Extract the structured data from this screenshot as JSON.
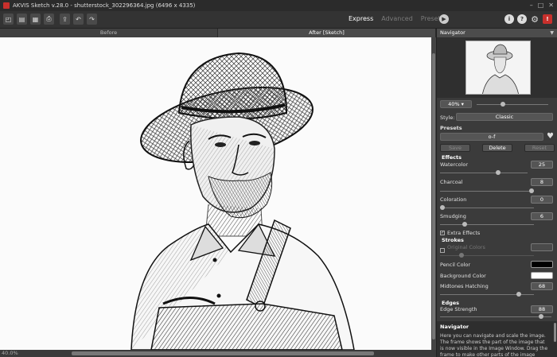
{
  "window": {
    "title": "AKVIS Sketch v.28.0 - shutterstock_302296364.jpg (6496 x 4335)"
  },
  "toolbar": {
    "modes": {
      "express": "Express",
      "advanced": "Advanced",
      "presets": "Presets"
    }
  },
  "tabs": {
    "before": "Before",
    "after": "After [Sketch]"
  },
  "status": {
    "zoom": "40.0%"
  },
  "panel": {
    "navigator_title": "Navigator",
    "zoom_value": "40%",
    "style_label": "Style:",
    "style_value": "Classic",
    "presets_label": "Presets",
    "preset_value": "o-f",
    "save_label": "Save",
    "delete_label": "Delete",
    "reset_label": "Reset",
    "effects_label": "Effects",
    "watercolor_label": "Watercolor",
    "watercolor_value": "25",
    "charcoal_label": "Charcoal",
    "charcoal_value": "8",
    "coloration_label": "Coloration",
    "coloration_value": "0",
    "smudging_label": "Smudging",
    "smudging_value": "6",
    "extra_effects_label": "Extra Effects",
    "strokes_label": "Strokes",
    "original_colors_label": "Original Colors",
    "pencil_color_label": "Pencil Color",
    "background_color_label": "Background Color",
    "midtones_label": "Midtones Hatching",
    "midtones_value": "68",
    "edges_label": "Edges",
    "edge_strength_label": "Edge Strength",
    "edge_strength_value": "88",
    "pencil_color": "#000000",
    "background_color": "#ffffff"
  },
  "help": {
    "title": "Navigator",
    "body": "Here you can navigate and scale the image. The frame shows the part of the image that is now visible in the Image Window. Drag the frame to make other parts of the image visible. Use the"
  }
}
